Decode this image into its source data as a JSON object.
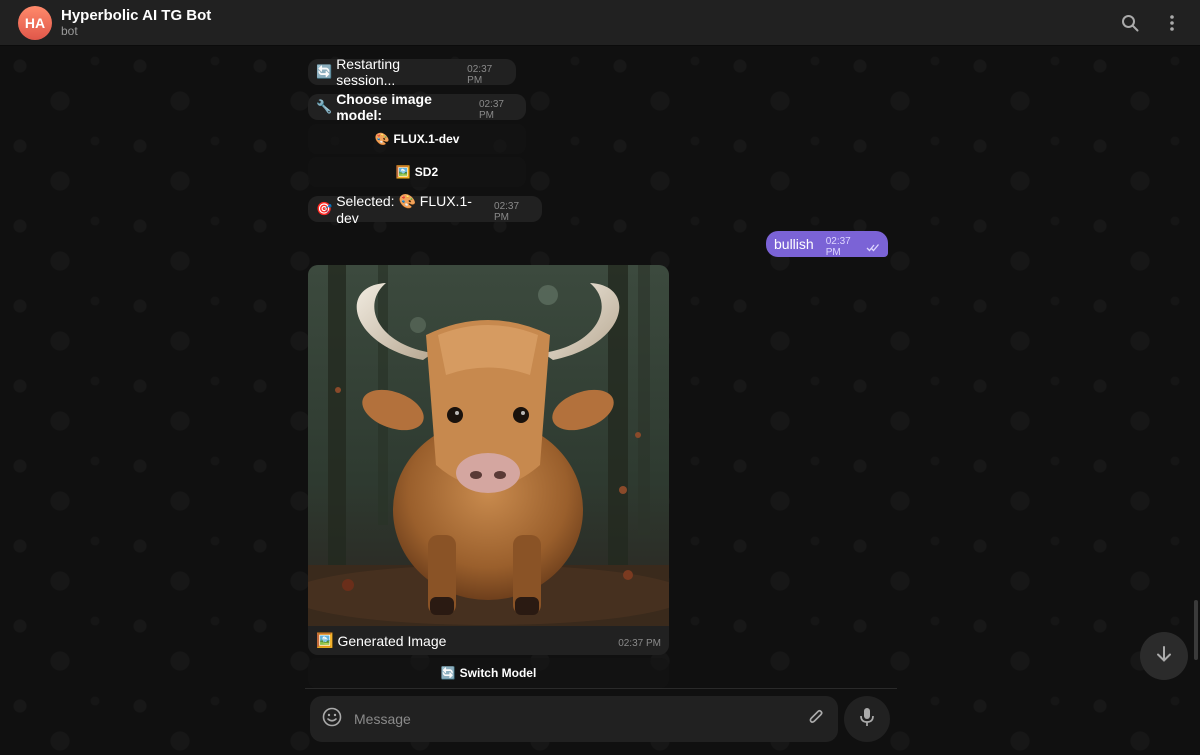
{
  "header": {
    "avatar_initials": "HA",
    "title": "Hyperbolic AI TG Bot",
    "subtitle": "bot"
  },
  "messages": {
    "restarting": {
      "emoji": "🔄",
      "text": "Restarting session...",
      "time": "02:37 PM"
    },
    "choose_model": {
      "emoji": "🔧",
      "text": "Choose image model:",
      "time": "02:37 PM"
    },
    "selected": {
      "emoji": "🎯",
      "text": "Selected: 🎨 FLUX.1-dev",
      "time": "02:37 PM"
    },
    "outgoing": {
      "text": "bullish",
      "time": "02:37 PM",
      "status": "read"
    },
    "photo": {
      "caption_emoji": "🖼️",
      "caption": "Generated Image",
      "time": "02:37 PM"
    }
  },
  "keyboard": {
    "flux": {
      "emoji": "🎨",
      "label": "FLUX.1-dev"
    },
    "sd2": {
      "emoji": "🖼️",
      "label": "SD2"
    },
    "switch": {
      "emoji": "🔄",
      "label": "Switch Model"
    }
  },
  "composer": {
    "placeholder": "Message"
  },
  "colors": {
    "header_bg": "#212121",
    "bubble_in": "#212121",
    "bubble_out": "#7b63d6",
    "avatar": "#e0574a"
  },
  "icons": [
    "search-icon",
    "more-vertical-icon",
    "emoji-icon",
    "attach-icon",
    "mic-icon",
    "arrow-down-icon",
    "double-check-icon"
  ]
}
